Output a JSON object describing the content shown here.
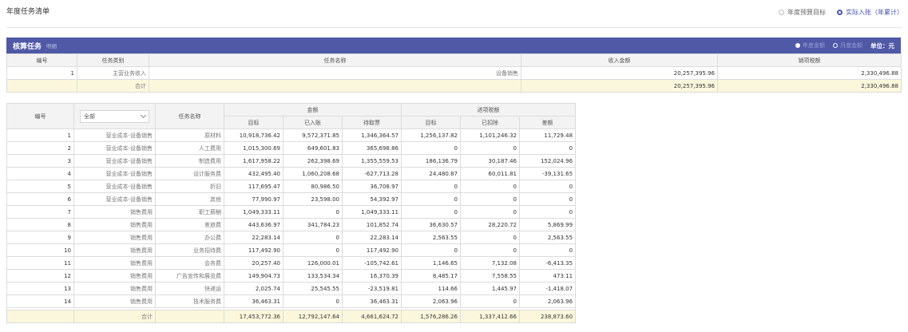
{
  "page": {
    "title": "年度任务清单"
  },
  "view_switch": {
    "options": [
      "年度预算目标",
      "实际入账（年累计）"
    ],
    "active_index": 1
  },
  "section": {
    "title": "核算任务",
    "subtitle": "明细",
    "amount_options": [
      "年度金额",
      "月度金额"
    ],
    "active_amount_index": 1,
    "unit": "单位：元"
  },
  "task_table": {
    "headers": [
      "编号",
      "任务类别",
      "任务名称",
      "收入金额",
      "销项税额"
    ],
    "rows": [
      {
        "no": "1",
        "category": "主营业务收入",
        "name": "设备销售",
        "income": "20,257,395.96",
        "tax": "2,330,496.88"
      }
    ],
    "total": {
      "label": "合计",
      "income": "20,257,395.96",
      "tax": "2,330,496.88"
    }
  },
  "cost_table": {
    "headers": {
      "no": "编号",
      "filter_value": "全部",
      "name": "任务名称",
      "amount_group": "金额",
      "tax_group": "进项税额",
      "amount_cols": [
        "目标",
        "已入账",
        "待取票"
      ],
      "tax_cols": [
        "目标",
        "已扣除",
        "差额"
      ]
    },
    "rows": [
      {
        "no": "1",
        "category": "营业成本-设备销售",
        "name": "原材料",
        "v": [
          "10,918,736.42",
          "9,572,371.85",
          "1,346,364.57",
          "1,256,137.82",
          "1,101,246.32",
          "11,729.48"
        ]
      },
      {
        "no": "2",
        "category": "营业成本-设备销售",
        "name": "人工费用",
        "v": [
          "1,015,300.69",
          "649,601.83",
          "365,698.86",
          "0",
          "0",
          "0"
        ]
      },
      {
        "no": "3",
        "category": "营业成本-设备销售",
        "name": "制造费用",
        "v": [
          "1,617,958.22",
          "262,398.69",
          "1,355,559.53",
          "186,136.79",
          "30,187.46",
          "152,024.96"
        ]
      },
      {
        "no": "4",
        "category": "营业成本-设备销售",
        "name": "设计服务费",
        "v": [
          "432,495.40",
          "1,060,208.68",
          "-627,713.28",
          "24,480.87",
          "60,011.81",
          "-39,131.65"
        ]
      },
      {
        "no": "5",
        "category": "营业成本-设备销售",
        "name": "折旧",
        "v": [
          "117,695.47",
          "80,986.50",
          "36,708.97",
          "0",
          "0",
          "0"
        ]
      },
      {
        "no": "6",
        "category": "营业成本-设备销售",
        "name": "其他",
        "v": [
          "77,990.97",
          "23,598.00",
          "54,392.97",
          "0",
          "0",
          "0"
        ]
      },
      {
        "no": "7",
        "category": "销售费用",
        "name": "职工薪酬",
        "v": [
          "1,049,333.11",
          "0",
          "1,049,333.11",
          "0",
          "0",
          "0"
        ]
      },
      {
        "no": "8",
        "category": "销售费用",
        "name": "差旅费",
        "v": [
          "443,636.97",
          "341,784.23",
          "101,852.74",
          "36,630.57",
          "28,220.72",
          "5,869.99"
        ]
      },
      {
        "no": "9",
        "category": "销售费用",
        "name": "办公费",
        "v": [
          "22,283.14",
          "0",
          "22,283.14",
          "2,563.55",
          "0",
          "2,563.55"
        ]
      },
      {
        "no": "10",
        "category": "销售费用",
        "name": "业务招待费",
        "v": [
          "117,492.90",
          "0",
          "117,492.90",
          "0",
          "0",
          "0"
        ]
      },
      {
        "no": "11",
        "category": "销售费用",
        "name": "会务费",
        "v": [
          "20,257.40",
          "126,000.01",
          "-105,742.61",
          "1,146.65",
          "7,132.08",
          "-6,413.35"
        ]
      },
      {
        "no": "12",
        "category": "销售费用",
        "name": "广告宣传和展览费",
        "v": [
          "149,904.73",
          "133,534.34",
          "16,370.39",
          "8,485.17",
          "7,558.55",
          "473.11"
        ]
      },
      {
        "no": "13",
        "category": "销售费用",
        "name": "快递运",
        "v": [
          "2,025.74",
          "25,545.55",
          "-23,519.81",
          "114.66",
          "1,445.97",
          "-1,418.07"
        ]
      },
      {
        "no": "14",
        "category": "销售费用",
        "name": "技术服务费",
        "v": [
          "36,463.31",
          "0",
          "36,463.31",
          "2,063.96",
          "0",
          "2,063.96"
        ]
      }
    ],
    "total": {
      "label": "合计",
      "v": [
        "17,453,772.36",
        "12,792,147.64",
        "4,661,624.72",
        "1,576,286.26",
        "1,337,412.66",
        "238,873.60"
      ]
    }
  },
  "colors": {
    "header_bar": "#4f59a6",
    "accent": "#4a56b5",
    "total_row": "#fbf7dc"
  }
}
